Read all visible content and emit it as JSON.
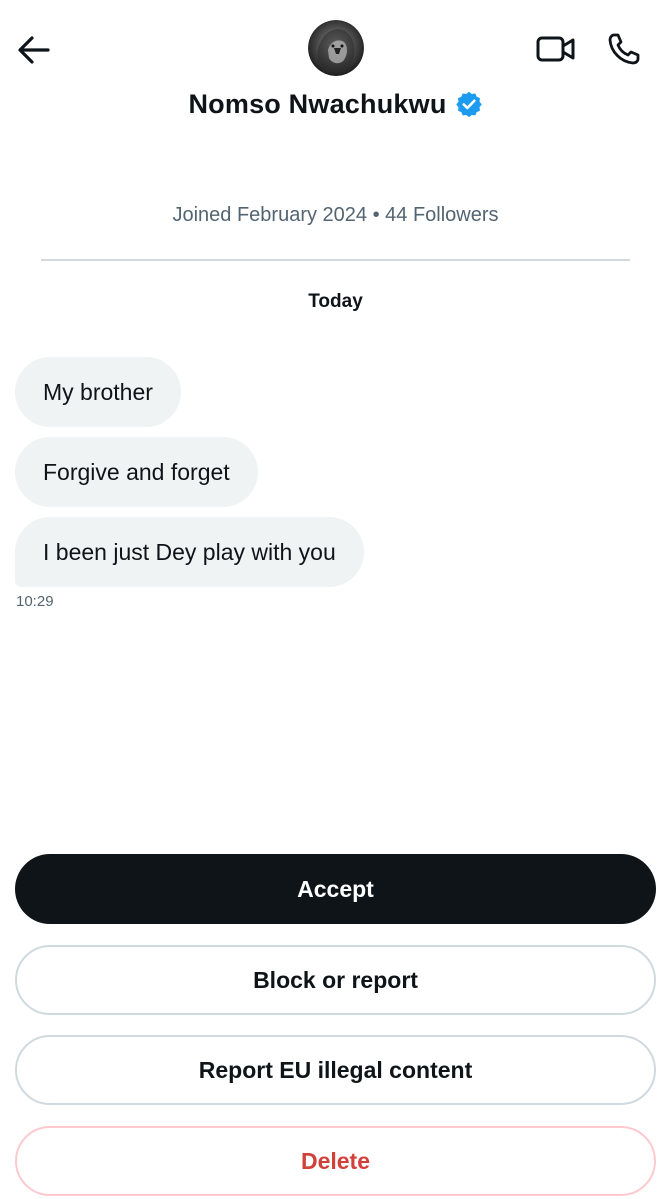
{
  "header": {
    "name": "Nomso Nwachukwu",
    "back_icon": "arrow-left-icon",
    "video_icon": "video-camera-icon",
    "call_icon": "phone-icon",
    "verified_icon": "verified-badge-icon",
    "verified_color": "#1d9bf0"
  },
  "profile_meta": "Joined February 2024 • 44 Followers",
  "conversation": {
    "day_label": "Today",
    "messages": [
      {
        "text": "My brother"
      },
      {
        "text": "Forgive and forget"
      },
      {
        "text": "I been just Dey play with you"
      }
    ],
    "last_time": "10:29"
  },
  "actions": {
    "accept": "Accept",
    "block": "Block or report",
    "report_eu": "Report EU illegal content",
    "delete": "Delete"
  },
  "colors": {
    "primary_text": "#0f1419",
    "secondary_text": "#536471",
    "bubble_bg": "#eff3f4",
    "danger": "#d2403a",
    "accept_bg": "#0f1419"
  }
}
